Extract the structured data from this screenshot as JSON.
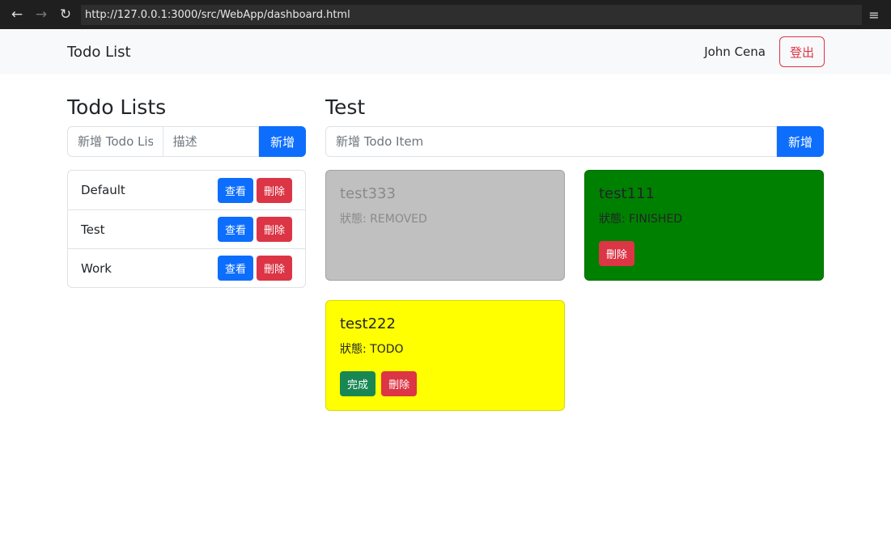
{
  "browser": {
    "url": "http://127.0.0.1:3000/src/WebApp/dashboard.html"
  },
  "navbar": {
    "brand": "Todo List",
    "user": "John Cena",
    "logout": "登出"
  },
  "lists": {
    "title": "Todo Lists",
    "name_placeholder": "新增 Todo List",
    "desc_placeholder": "描述",
    "add": "新增",
    "items": [
      {
        "name": "Default",
        "view": "查看",
        "delete": "刪除"
      },
      {
        "name": "Test",
        "view": "查看",
        "delete": "刪除"
      },
      {
        "name": "Work",
        "view": "查看",
        "delete": "刪除"
      }
    ]
  },
  "detail": {
    "title": "Test",
    "item_placeholder": "新增 Todo Item",
    "add": "新增",
    "items": [
      {
        "title": "test333",
        "status": "狀態: REMOVED",
        "bg": "#c0c0c0",
        "fg": "#8a8a8a"
      },
      {
        "title": "test111",
        "status": "狀態: FINISHED",
        "bg": "#008000",
        "fg": "#212529",
        "delete": "刪除"
      },
      {
        "title": "test222",
        "status": "狀態: TODO",
        "bg": "#ffff00",
        "fg": "#212529",
        "complete": "完成",
        "delete": "刪除"
      }
    ]
  }
}
